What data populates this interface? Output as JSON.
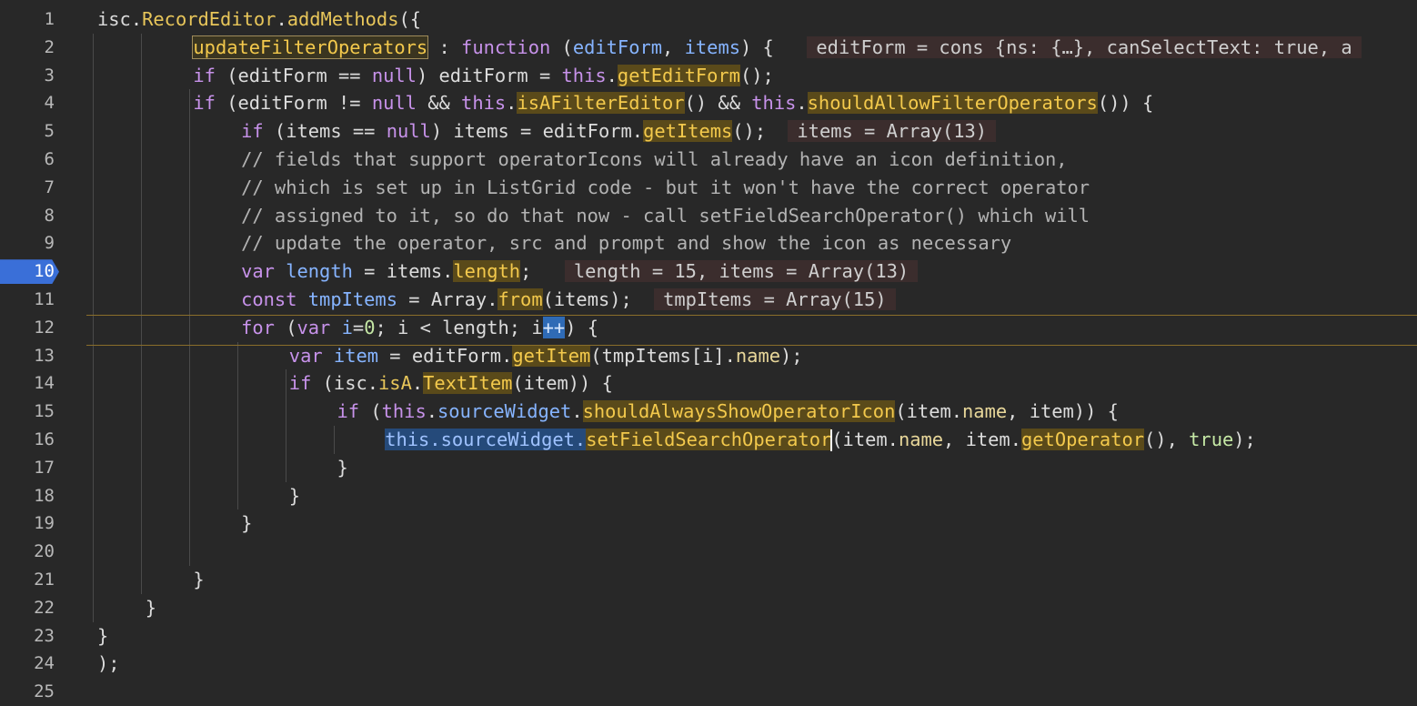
{
  "editor": {
    "active_line": "10",
    "lines": [
      {
        "n": "1",
        "indent": 0,
        "tokens": [
          [
            "pl",
            "isc."
          ],
          [
            "fn",
            "RecordEditor"
          ],
          [
            "pl",
            "."
          ],
          [
            "fn",
            "addMethods"
          ],
          [
            "pl",
            "({"
          ]
        ]
      },
      {
        "n": "2",
        "indent": 2,
        "tokens": [
          [
            "hl-box",
            "updateFilterOperators"
          ],
          [
            "pl",
            " : "
          ],
          [
            "k",
            "function"
          ],
          [
            "pl",
            " ("
          ],
          [
            "id",
            "editForm"
          ],
          [
            "pl",
            ", "
          ],
          [
            "id",
            "items"
          ],
          [
            "pl",
            ") {  "
          ],
          [
            "inline",
            "editForm = cons {ns: {…}, canSelectText: true, a"
          ]
        ]
      },
      {
        "n": "3",
        "indent": 2,
        "tokens": [
          [
            "k",
            "if"
          ],
          [
            "pl",
            " (editForm == "
          ],
          [
            "k",
            "null"
          ],
          [
            "pl",
            ") editForm = "
          ],
          [
            "k",
            "this"
          ],
          [
            "pl",
            "."
          ],
          [
            "hl",
            "getEditForm"
          ],
          [
            "pl",
            "();"
          ]
        ]
      },
      {
        "n": "4",
        "indent": 2,
        "tokens": [
          [
            "k",
            "if"
          ],
          [
            "pl",
            " (editForm != "
          ],
          [
            "k",
            "null"
          ],
          [
            "pl",
            " && "
          ],
          [
            "k",
            "this"
          ],
          [
            "pl",
            "."
          ],
          [
            "hl",
            "isAFilterEditor"
          ],
          [
            "pl",
            "() && "
          ],
          [
            "k",
            "this"
          ],
          [
            "pl",
            "."
          ],
          [
            "hl",
            "shouldAllowFilterOperators"
          ],
          [
            "pl",
            "()) {"
          ]
        ]
      },
      {
        "n": "5",
        "indent": 3,
        "tokens": [
          [
            "k",
            "if"
          ],
          [
            "pl",
            " (items == "
          ],
          [
            "k",
            "null"
          ],
          [
            "pl",
            ") items = editForm."
          ],
          [
            "hl",
            "getItems"
          ],
          [
            "pl",
            "(); "
          ],
          [
            "inline",
            "items = Array(13)"
          ]
        ]
      },
      {
        "n": "6",
        "indent": 3,
        "tokens": [
          [
            "cm",
            "// fields that support operatorIcons will already have an icon definition,"
          ]
        ]
      },
      {
        "n": "7",
        "indent": 3,
        "tokens": [
          [
            "cm",
            "// which is set up in ListGrid code - but it won't have the correct operator"
          ]
        ]
      },
      {
        "n": "8",
        "indent": 3,
        "tokens": [
          [
            "cm",
            "// assigned to it, so do that now - call setFieldSearchOperator() which will"
          ]
        ]
      },
      {
        "n": "9",
        "indent": 3,
        "tokens": [
          [
            "cm",
            "// update the operator, src and prompt and show the icon as necessary"
          ]
        ]
      },
      {
        "n": "10",
        "indent": 3,
        "tokens": [
          [
            "k",
            "var"
          ],
          [
            "pl",
            " "
          ],
          [
            "id",
            "length"
          ],
          [
            "pl",
            " = items."
          ],
          [
            "hl",
            "length"
          ],
          [
            "pl",
            ";  "
          ],
          [
            "inline",
            "length = 15, items = Array(13)"
          ]
        ]
      },
      {
        "n": "11",
        "indent": 3,
        "tokens": [
          [
            "k",
            "const"
          ],
          [
            "pl",
            " "
          ],
          [
            "id",
            "tmpItems"
          ],
          [
            "pl",
            " = Array."
          ],
          [
            "hl",
            "from"
          ],
          [
            "pl",
            "(items); "
          ],
          [
            "inline",
            "tmpItems = Array(15)"
          ]
        ]
      },
      {
        "n": "12",
        "indent": 3,
        "tokens": [
          [
            "k",
            "for"
          ],
          [
            "pl",
            " ("
          ],
          [
            "k",
            "var"
          ],
          [
            "pl",
            " "
          ],
          [
            "id",
            "i"
          ],
          [
            "pl",
            "="
          ],
          [
            "grn",
            "0"
          ],
          [
            "pl",
            "; i < length; i"
          ],
          [
            "sel-strong",
            "++"
          ],
          [
            "pl",
            ") {"
          ]
        ]
      },
      {
        "n": "13",
        "indent": 4,
        "tokens": [
          [
            "k",
            "var"
          ],
          [
            "pl",
            " "
          ],
          [
            "id",
            "item"
          ],
          [
            "pl",
            " = editForm."
          ],
          [
            "hl",
            "getItem"
          ],
          [
            "pl",
            "(tmpItems[i]."
          ],
          [
            "nm",
            "name"
          ],
          [
            "pl",
            ");"
          ]
        ]
      },
      {
        "n": "14",
        "indent": 4,
        "tokens": [
          [
            "k",
            "if"
          ],
          [
            "pl",
            " (isc."
          ],
          [
            "fn",
            "isA"
          ],
          [
            "pl",
            "."
          ],
          [
            "hl",
            "TextItem"
          ],
          [
            "pl",
            "(item)) {"
          ]
        ]
      },
      {
        "n": "15",
        "indent": 5,
        "tokens": [
          [
            "k",
            "if"
          ],
          [
            "pl",
            " ("
          ],
          [
            "k",
            "this"
          ],
          [
            "pl",
            "."
          ],
          [
            "id",
            "sourceWidget"
          ],
          [
            "pl",
            "."
          ],
          [
            "hl",
            "shouldAlwaysShowOperatorIcon"
          ],
          [
            "pl",
            "(item."
          ],
          [
            "nm",
            "name"
          ],
          [
            "pl",
            ", item)) {"
          ]
        ]
      },
      {
        "n": "16",
        "indent": 6,
        "tokens": [
          [
            "sel",
            "this"
          ],
          [
            "sel",
            "."
          ],
          [
            "sel",
            "sourceWidget"
          ],
          [
            "sel",
            "."
          ],
          [
            "hl",
            "setFieldSearchOperator"
          ],
          [
            "cursor",
            ""
          ],
          [
            "pl",
            "(item."
          ],
          [
            "nm",
            "name"
          ],
          [
            "pl",
            ", item."
          ],
          [
            "hl",
            "getOperator"
          ],
          [
            "pl",
            "(), "
          ],
          [
            "grn",
            "true"
          ],
          [
            "pl",
            ");"
          ]
        ]
      },
      {
        "n": "17",
        "indent": 5,
        "tokens": [
          [
            "pl",
            "}"
          ]
        ]
      },
      {
        "n": "18",
        "indent": 4,
        "tokens": [
          [
            "pl",
            "}"
          ]
        ]
      },
      {
        "n": "19",
        "indent": 3,
        "tokens": [
          [
            "pl",
            "}"
          ]
        ]
      },
      {
        "n": "20",
        "indent": 3,
        "tokens": []
      },
      {
        "n": "21",
        "indent": 2,
        "tokens": [
          [
            "pl",
            "}"
          ]
        ]
      },
      {
        "n": "22",
        "indent": 1,
        "tokens": [
          [
            "pl",
            "}"
          ]
        ]
      },
      {
        "n": "23",
        "indent": 0,
        "tokens": [
          [
            "pl",
            "}"
          ]
        ]
      },
      {
        "n": "24",
        "indent": 0,
        "tokens": [
          [
            "pl",
            ");"
          ]
        ]
      },
      {
        "n": "25",
        "indent": 0,
        "tokens": []
      }
    ],
    "colors": {
      "background": "#282828",
      "breakpoint": "#3a6fd8",
      "keyword": "#c792ea",
      "highlight": "#f3c94c"
    }
  }
}
